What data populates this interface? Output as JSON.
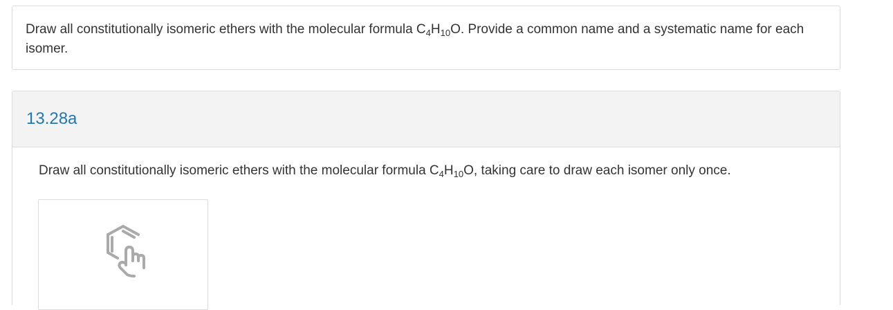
{
  "intro": {
    "text_part1": "Draw all constitutionally isomeric ethers with the molecular formula C",
    "sub_c": "4",
    "text_h": "H",
    "sub_h": "10",
    "text_part2": "O. Provide a common name and a systematic name for each isomer."
  },
  "question": {
    "id": "13.28a",
    "text_part1": "Draw all constitutionally isomeric ethers with the molecular formula C",
    "sub_c": "4",
    "text_h": "H",
    "sub_h": "10",
    "text_part2": "O, taking care to draw each isomer only once."
  },
  "drawing_area": {
    "icon": "molecule-draw-hand-icon",
    "icon_color": "#aaaaaa"
  },
  "colors": {
    "accent": "#1f78b4",
    "header_bg": "#f3f3f3",
    "border": "#dcdcdc"
  }
}
